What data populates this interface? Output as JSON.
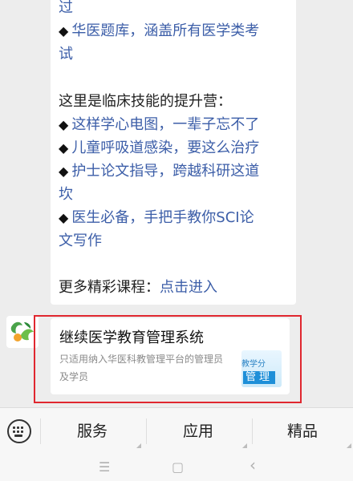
{
  "message": {
    "lines": [
      {
        "type": "link",
        "text": "过"
      },
      {
        "type": "item",
        "text": "华医题库，涵盖所有医学类考"
      },
      {
        "type": "link",
        "text": "试"
      },
      {
        "type": "plain",
        "text": "这里是临床技能的提升营："
      },
      {
        "type": "item",
        "text": "这样学心电图，一辈子忘不了"
      },
      {
        "type": "item",
        "text": "儿童呼吸道感染，要这么治疗"
      },
      {
        "type": "item",
        "text": "护士论文指导，跨越科研这道"
      },
      {
        "type": "link",
        "text": "坎"
      },
      {
        "type": "item",
        "text": "医生必备，手把手教你SCI论"
      },
      {
        "type": "link",
        "text": "文写作"
      }
    ],
    "more_label": "更多精彩课程：",
    "more_link": "点击进入",
    "diamond": "◆"
  },
  "card": {
    "title": "继续医学教育管理系统",
    "description": "只适用纳入华医科教管理平台的管理员及学员",
    "thumb_top": "教学分",
    "thumb_bottom": "管理"
  },
  "menu": {
    "items": [
      "服务",
      "应用",
      "精品"
    ]
  },
  "navbar": {
    "menu_icon": "☰",
    "home_icon": "▢",
    "back_icon": "‹"
  },
  "colors": {
    "link": "#3c5ea8",
    "highlight": "#e0272f"
  }
}
